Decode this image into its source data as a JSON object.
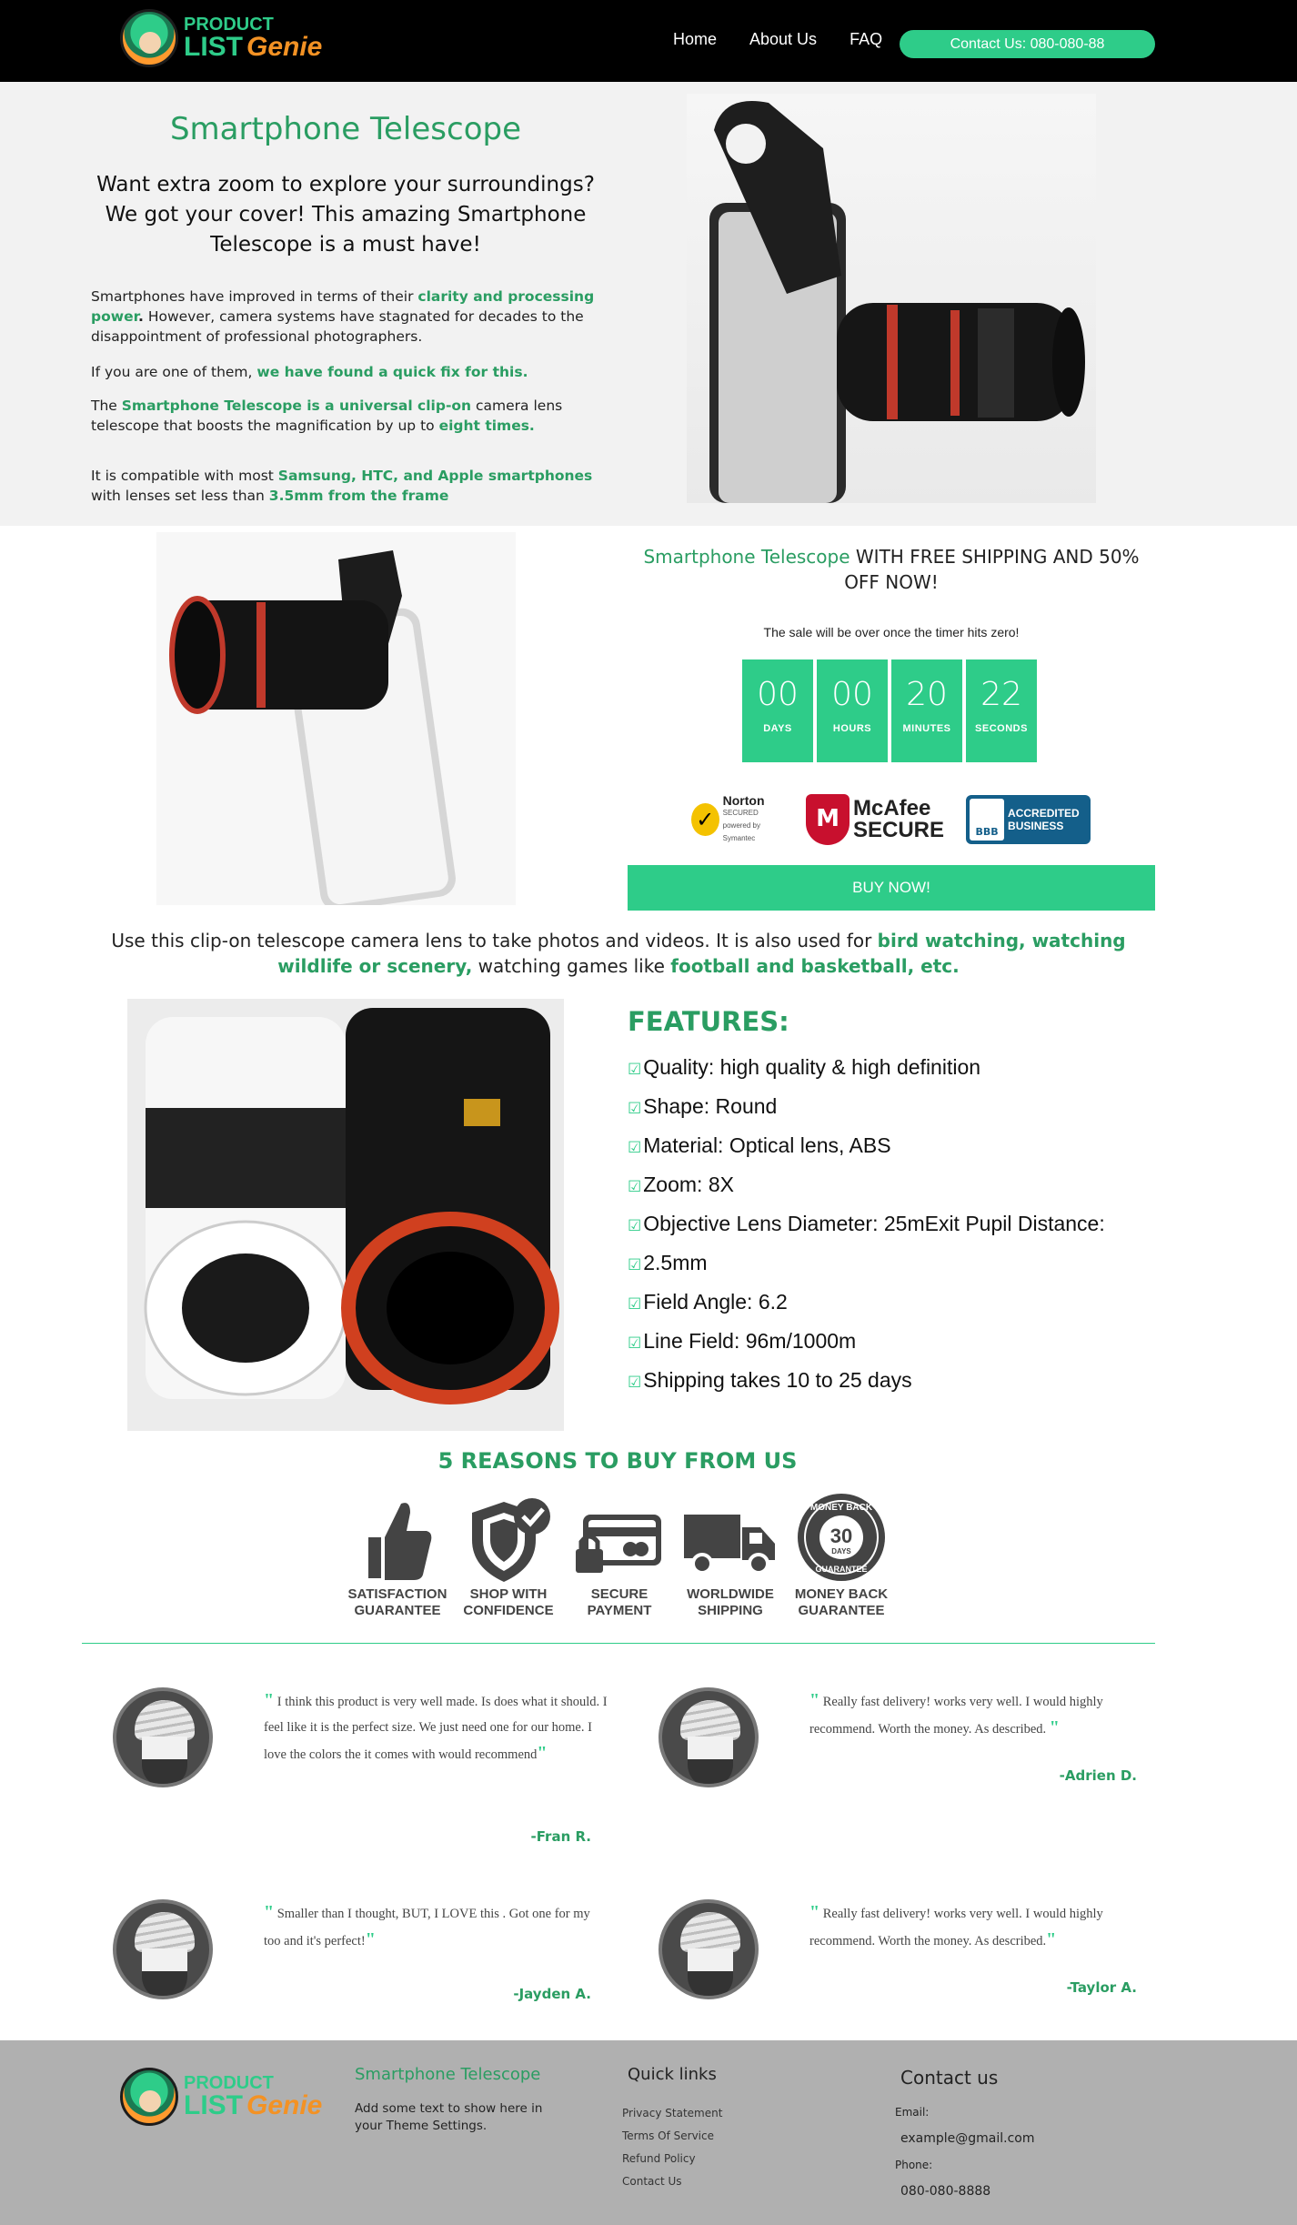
{
  "brand": {
    "line1": "PRODUCT",
    "line2a": "LIST",
    "line2b": "Genie"
  },
  "nav": {
    "home": "Home",
    "about": "About Us",
    "faq": "FAQ",
    "contact_btn": "Contact Us: 080-080-88"
  },
  "hero": {
    "title": "Smartphone Telescope",
    "subtitle": "Want extra zoom to explore your surroundings? We got your cover! This amazing Smartphone Telescope is a must have!",
    "p1_a": "Smartphones have improved in terms of their ",
    "p1_b": "clarity and processing power",
    "p1_c": ".",
    "p1_d": " However, camera systems have stagnated for decades to the disappointment of professional photographers.",
    "p2_a": "If you are one of them, ",
    "p2_b": "we have found a quick fix for this.",
    "p3_a": "The ",
    "p3_b": "Smartphone Telescope is a universal clip-on",
    "p3_c": " camera lens telescope that boosts the magnification by up to ",
    "p3_d": "eight times.",
    "p4_a": " It is compatible with most ",
    "p4_b": "Samsung, HTC, and Apple smartphones",
    "p4_c": " with lenses set less than ",
    "p4_d": "3.5mm from the frame"
  },
  "offer": {
    "title_green": "Smartphone Telescope",
    "title_rest": " WITH FREE SHIPPING AND 50% OFF NOW!",
    "timer_note": "The sale will be over once the timer hits zero!",
    "timer": [
      {
        "value": "00",
        "label": "DAYS"
      },
      {
        "value": "00",
        "label": "HOURS"
      },
      {
        "value": "20",
        "label": "MINUTES"
      },
      {
        "value": "22",
        "label": "SECONDS"
      }
    ],
    "badges": {
      "norton": "Norton",
      "norton_sub": "SECURED",
      "norton_power": "powered by Symantec",
      "mcafee": "McAfee",
      "mcafee_sub": "SECURE",
      "bbb": "BBB",
      "bbb_text1": "ACCREDITED",
      "bbb_text2": "BUSINESS"
    },
    "buy_label": "BUY NOW!"
  },
  "usage": {
    "a": "Use this clip-on telescope camera lens to take photos and videos. It is also used for ",
    "b": "bird watching, watching wildlife or scenery,",
    "c": " watching games like ",
    "d": "football and basketball, etc."
  },
  "features": {
    "title": "FEATURES:",
    "items": [
      "Quality: high quality & high definition",
      "Shape: Round",
      "Material: Optical lens, ABS",
      "Zoom: 8X",
      "Objective Lens Diameter: 25mExit Pupil Distance:",
      "2.5mm",
      "Field Angle: 6.2",
      "Line Field: 96m/1000m",
      "Shipping takes 10 to 25 days"
    ]
  },
  "reasons": {
    "title": "5 REASONS TO BUY FROM US",
    "items": [
      {
        "l1": "SATISFACTION",
        "l2": "GUARANTEE"
      },
      {
        "l1": "SHOP WITH",
        "l2": "CONFIDENCE"
      },
      {
        "l1": "SECURE",
        "l2": "PAYMENT"
      },
      {
        "l1": "WORLDWIDE",
        "l2": "SHIPPING"
      },
      {
        "l1": "MONEY BACK",
        "l2": "GUARANTEE"
      }
    ],
    "seal_top": "MONEY BACK",
    "seal_num": "30",
    "seal_days": "DAYS",
    "seal_bottom": "GUARANTEE"
  },
  "testimonials": [
    {
      "text": " I think this product is very well made. Is does what it should. I feel like it is the perfect size. We just need one for our home. I love the colors the it comes with would recommend",
      "author": "-Fran R."
    },
    {
      "text": " Really fast delivery! works very well. I would highly recommend. Worth the money. As described. ",
      "author": "-Adrien D."
    },
    {
      "text": " Smaller than I thought, BUT, I LOVE this . Got one for my too and it's perfect!",
      "author": "-Jayden A."
    },
    {
      "text": " Really fast delivery! works very well. I would highly recommend. Worth the money. As described.",
      "author": "-Taylor A."
    }
  ],
  "quote_mark": "\"",
  "footer": {
    "product_title": "Smartphone Telescope",
    "product_text": "Add some text to show here in your Theme Settings.",
    "links_title": "Quick links",
    "links": [
      "Privacy Statement",
      "Terms Of Service",
      "Refund Policy",
      "Contact Us"
    ],
    "contact_title": "Contact us",
    "email_label": "Email:",
    "email": "example@gmail.com",
    "phone_label": "Phone:",
    "phone": "080-080-8888"
  },
  "colors": {
    "accent": "#2ecc89",
    "accent_text": "#2a9d62",
    "header_bg": "#000000",
    "hero_bg": "#f2f2f2",
    "footer_bg": "#b0b0b0"
  }
}
